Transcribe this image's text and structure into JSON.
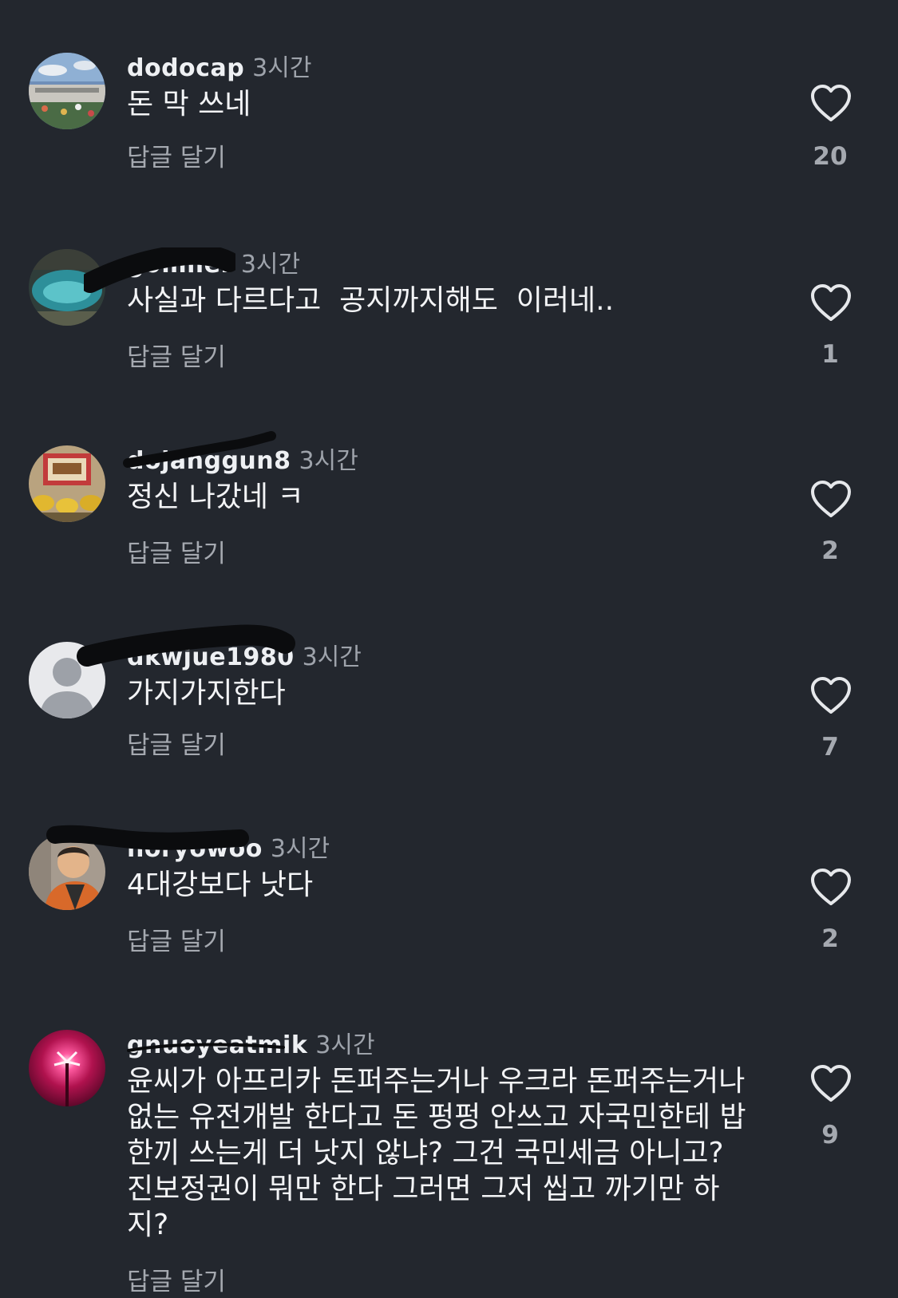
{
  "comments": [
    {
      "username": "dodocap",
      "time": "3시간",
      "text": "돈 막 쓰네",
      "reply_label": "답글 달기",
      "likes": "20"
    },
    {
      "username": "g0miler",
      "time": "3시간",
      "text": "사실과 다르다고  공지까지해도  이러네..",
      "reply_label": "답글 달기",
      "likes": "1"
    },
    {
      "username": "dojanggun8",
      "time": "3시간",
      "text": "정신 나갔네 ㅋ",
      "reply_label": "답글 달기",
      "likes": "2"
    },
    {
      "username": "dkwjue1980",
      "time": "3시간",
      "text": "가지가지한다",
      "reply_label": "답글 달기",
      "likes": "7"
    },
    {
      "username": "horyowoo",
      "time": "3시간",
      "text": "4대강보다 낫다",
      "reply_label": "답글 달기",
      "likes": "2"
    },
    {
      "username": "gnuoyeatmik",
      "time": "3시간",
      "text": "윤씨가 아프리카 돈퍼주는거나 우크라 돈퍼주는거나\n없는 유전개발 한다고 돈 펑펑 안쓰고 자국민한테 밥\n한끼 쓰는게 더 낫지 않냐? 그건 국민세금 아니고?\n진보정권이 뭐만 한다 그러면 그저 씹고 까기만 하\n지?",
      "reply_label": "답글 달기",
      "likes": "9"
    }
  ],
  "icons": {
    "like": "heart-outline-icon",
    "default_avatar": "person-silhouette-icon"
  },
  "colors": {
    "background": "#23272e",
    "primary_text": "#f2f3f5",
    "secondary_text": "#a5a9b0"
  }
}
